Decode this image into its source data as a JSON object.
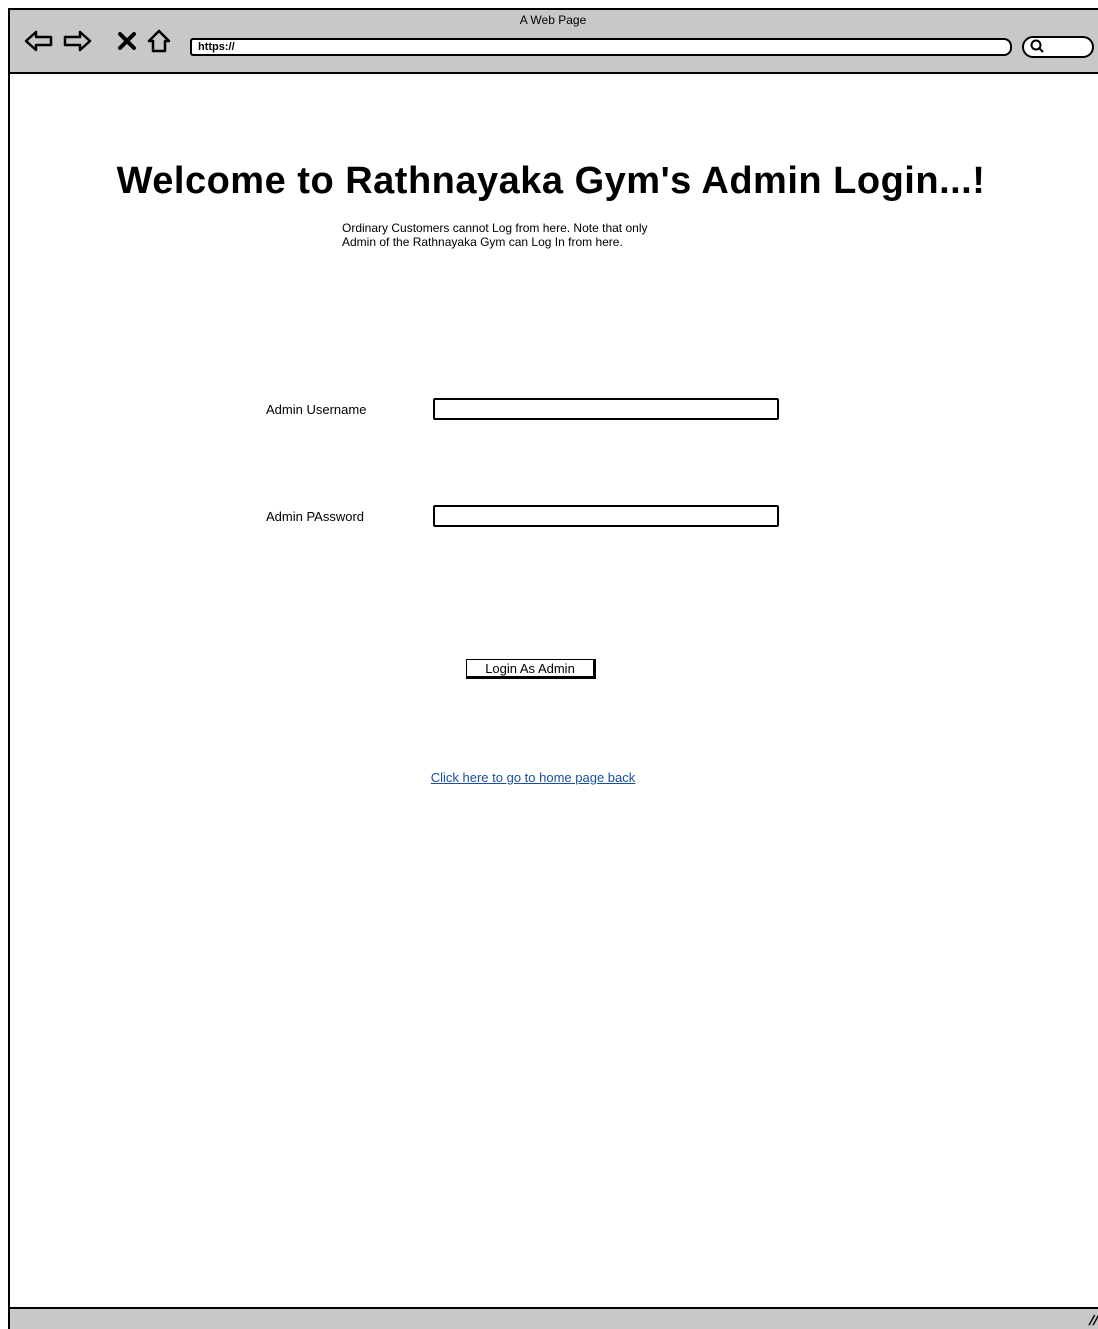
{
  "window": {
    "title": "A Web Page"
  },
  "browser": {
    "url": "https://",
    "icons": [
      "back-arrow-icon",
      "forward-arrow-icon",
      "close-icon",
      "home-icon",
      "search-icon"
    ]
  },
  "page": {
    "heading": "Welcome to Rathnayaka Gym's Admin Login...!",
    "note_line1": "Ordinary Customers cannot Log from here. Note that only",
    "note_line2": "Admin of the Rathnayaka Gym can Log In from here.",
    "username_label": "Admin Username",
    "username_value": "",
    "password_label": "Admin PAssword",
    "password_value": "",
    "login_button": "Login As Admin",
    "home_link": "Click here to go to home page back"
  },
  "colors": {
    "chrome": "#c8c8c8",
    "link": "#1a4fa0"
  }
}
